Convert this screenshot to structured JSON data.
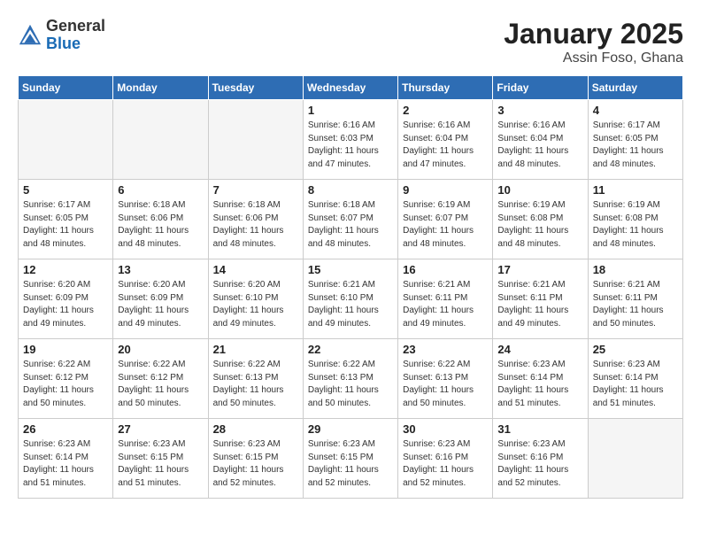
{
  "header": {
    "logo_general": "General",
    "logo_blue": "Blue",
    "month": "January 2025",
    "location": "Assin Foso, Ghana"
  },
  "weekdays": [
    "Sunday",
    "Monday",
    "Tuesday",
    "Wednesday",
    "Thursday",
    "Friday",
    "Saturday"
  ],
  "weeks": [
    [
      {
        "day": "",
        "info": ""
      },
      {
        "day": "",
        "info": ""
      },
      {
        "day": "",
        "info": ""
      },
      {
        "day": "1",
        "info": "Sunrise: 6:16 AM\nSunset: 6:03 PM\nDaylight: 11 hours\nand 47 minutes."
      },
      {
        "day": "2",
        "info": "Sunrise: 6:16 AM\nSunset: 6:04 PM\nDaylight: 11 hours\nand 47 minutes."
      },
      {
        "day": "3",
        "info": "Sunrise: 6:16 AM\nSunset: 6:04 PM\nDaylight: 11 hours\nand 48 minutes."
      },
      {
        "day": "4",
        "info": "Sunrise: 6:17 AM\nSunset: 6:05 PM\nDaylight: 11 hours\nand 48 minutes."
      }
    ],
    [
      {
        "day": "5",
        "info": "Sunrise: 6:17 AM\nSunset: 6:05 PM\nDaylight: 11 hours\nand 48 minutes."
      },
      {
        "day": "6",
        "info": "Sunrise: 6:18 AM\nSunset: 6:06 PM\nDaylight: 11 hours\nand 48 minutes."
      },
      {
        "day": "7",
        "info": "Sunrise: 6:18 AM\nSunset: 6:06 PM\nDaylight: 11 hours\nand 48 minutes."
      },
      {
        "day": "8",
        "info": "Sunrise: 6:18 AM\nSunset: 6:07 PM\nDaylight: 11 hours\nand 48 minutes."
      },
      {
        "day": "9",
        "info": "Sunrise: 6:19 AM\nSunset: 6:07 PM\nDaylight: 11 hours\nand 48 minutes."
      },
      {
        "day": "10",
        "info": "Sunrise: 6:19 AM\nSunset: 6:08 PM\nDaylight: 11 hours\nand 48 minutes."
      },
      {
        "day": "11",
        "info": "Sunrise: 6:19 AM\nSunset: 6:08 PM\nDaylight: 11 hours\nand 48 minutes."
      }
    ],
    [
      {
        "day": "12",
        "info": "Sunrise: 6:20 AM\nSunset: 6:09 PM\nDaylight: 11 hours\nand 49 minutes."
      },
      {
        "day": "13",
        "info": "Sunrise: 6:20 AM\nSunset: 6:09 PM\nDaylight: 11 hours\nand 49 minutes."
      },
      {
        "day": "14",
        "info": "Sunrise: 6:20 AM\nSunset: 6:10 PM\nDaylight: 11 hours\nand 49 minutes."
      },
      {
        "day": "15",
        "info": "Sunrise: 6:21 AM\nSunset: 6:10 PM\nDaylight: 11 hours\nand 49 minutes."
      },
      {
        "day": "16",
        "info": "Sunrise: 6:21 AM\nSunset: 6:11 PM\nDaylight: 11 hours\nand 49 minutes."
      },
      {
        "day": "17",
        "info": "Sunrise: 6:21 AM\nSunset: 6:11 PM\nDaylight: 11 hours\nand 49 minutes."
      },
      {
        "day": "18",
        "info": "Sunrise: 6:21 AM\nSunset: 6:11 PM\nDaylight: 11 hours\nand 50 minutes."
      }
    ],
    [
      {
        "day": "19",
        "info": "Sunrise: 6:22 AM\nSunset: 6:12 PM\nDaylight: 11 hours\nand 50 minutes."
      },
      {
        "day": "20",
        "info": "Sunrise: 6:22 AM\nSunset: 6:12 PM\nDaylight: 11 hours\nand 50 minutes."
      },
      {
        "day": "21",
        "info": "Sunrise: 6:22 AM\nSunset: 6:13 PM\nDaylight: 11 hours\nand 50 minutes."
      },
      {
        "day": "22",
        "info": "Sunrise: 6:22 AM\nSunset: 6:13 PM\nDaylight: 11 hours\nand 50 minutes."
      },
      {
        "day": "23",
        "info": "Sunrise: 6:22 AM\nSunset: 6:13 PM\nDaylight: 11 hours\nand 50 minutes."
      },
      {
        "day": "24",
        "info": "Sunrise: 6:23 AM\nSunset: 6:14 PM\nDaylight: 11 hours\nand 51 minutes."
      },
      {
        "day": "25",
        "info": "Sunrise: 6:23 AM\nSunset: 6:14 PM\nDaylight: 11 hours\nand 51 minutes."
      }
    ],
    [
      {
        "day": "26",
        "info": "Sunrise: 6:23 AM\nSunset: 6:14 PM\nDaylight: 11 hours\nand 51 minutes."
      },
      {
        "day": "27",
        "info": "Sunrise: 6:23 AM\nSunset: 6:15 PM\nDaylight: 11 hours\nand 51 minutes."
      },
      {
        "day": "28",
        "info": "Sunrise: 6:23 AM\nSunset: 6:15 PM\nDaylight: 11 hours\nand 52 minutes."
      },
      {
        "day": "29",
        "info": "Sunrise: 6:23 AM\nSunset: 6:15 PM\nDaylight: 11 hours\nand 52 minutes."
      },
      {
        "day": "30",
        "info": "Sunrise: 6:23 AM\nSunset: 6:16 PM\nDaylight: 11 hours\nand 52 minutes."
      },
      {
        "day": "31",
        "info": "Sunrise: 6:23 AM\nSunset: 6:16 PM\nDaylight: 11 hours\nand 52 minutes."
      },
      {
        "day": "",
        "info": ""
      }
    ]
  ]
}
